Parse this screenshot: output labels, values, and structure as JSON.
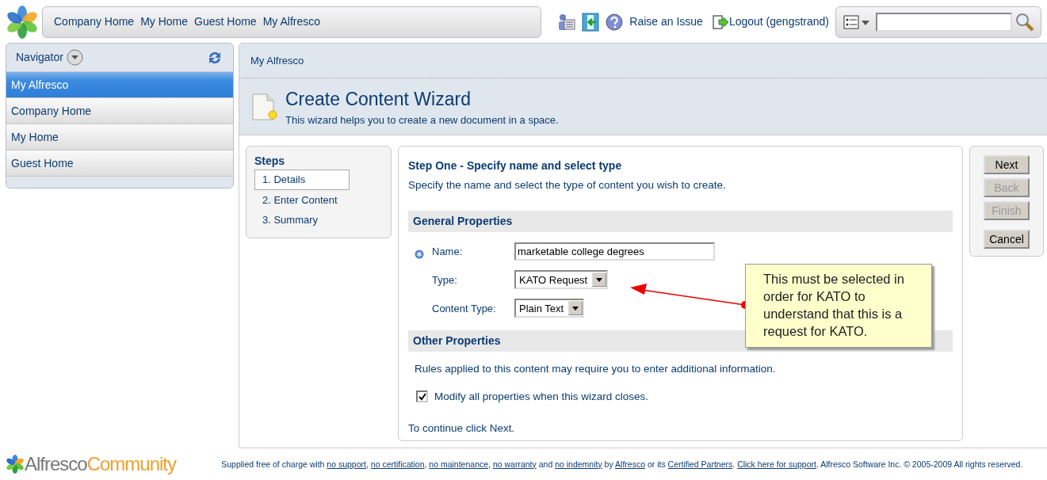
{
  "top_links": [
    {
      "label": "Company Home"
    },
    {
      "label": "My Home"
    },
    {
      "label": "Guest Home"
    },
    {
      "label": "My Alfresco"
    }
  ],
  "toolbar": {
    "raise_issue": "Raise an Issue",
    "logout": "Logout (gengstrand)"
  },
  "navigator": {
    "title": "Navigator",
    "items": [
      {
        "label": "My Alfresco",
        "selected": true
      },
      {
        "label": "Company Home",
        "selected": false
      },
      {
        "label": "My Home",
        "selected": false
      },
      {
        "label": "Guest Home",
        "selected": false
      }
    ]
  },
  "breadcrumb": "My Alfresco",
  "wizard": {
    "title": "Create Content Wizard",
    "description": "This wizard helps you to create a new document in a space."
  },
  "steps": {
    "title": "Steps",
    "items": [
      {
        "label": "1. Details",
        "selected": true
      },
      {
        "label": "2. Enter Content",
        "selected": false
      },
      {
        "label": "3. Summary",
        "selected": false
      }
    ]
  },
  "step": {
    "title": "Step One - Specify name and select type",
    "description": "Specify the name and select the type of content you wish to create.",
    "general_heading": "General Properties",
    "fields": [
      {
        "kind": "text",
        "label": "Name:",
        "required": true,
        "value": "marketable college degrees"
      },
      {
        "kind": "select",
        "label": "Type:",
        "required": false,
        "value": "KATO Request"
      },
      {
        "kind": "select",
        "label": "Content Type:",
        "required": false,
        "value": "Plain Text"
      }
    ],
    "other_heading": "Other Properties",
    "rules_text": "Rules applied to this content may require you to enter additional information.",
    "checkbox": {
      "label": "Modify all properties when this wizard closes.",
      "checked": true
    },
    "continue_text": "To continue click Next."
  },
  "buttons": [
    {
      "label": "Next",
      "disabled": false
    },
    {
      "label": "Back",
      "disabled": true
    },
    {
      "label": "Finish",
      "disabled": true
    },
    {
      "label": "Cancel",
      "disabled": false
    }
  ],
  "callout": {
    "text": "This must be selected in order for KATO to understand that this is a request for KATO."
  },
  "footer": {
    "brand": "Alfresco",
    "edition": "Community",
    "parts": [
      {
        "kind": "text",
        "text": "Supplied free of charge with "
      },
      {
        "kind": "link",
        "text": "no support"
      },
      {
        "kind": "text",
        "text": ", "
      },
      {
        "kind": "link",
        "text": "no certification"
      },
      {
        "kind": "text",
        "text": ", "
      },
      {
        "kind": "link",
        "text": "no maintenance"
      },
      {
        "kind": "text",
        "text": ", "
      },
      {
        "kind": "link",
        "text": "no warranty"
      },
      {
        "kind": "text",
        "text": " and "
      },
      {
        "kind": "link",
        "text": "no indemnity"
      },
      {
        "kind": "text",
        "text": " by "
      },
      {
        "kind": "link",
        "text": "Alfresco"
      },
      {
        "kind": "text",
        "text": " or its "
      },
      {
        "kind": "link",
        "text": "Certified Partners"
      },
      {
        "kind": "text",
        "text": ". "
      },
      {
        "kind": "link",
        "text": "Click here for support"
      },
      {
        "kind": "text",
        "text": ". Alfresco Software Inc. © 2005-2009 All rights reserved."
      }
    ]
  }
}
